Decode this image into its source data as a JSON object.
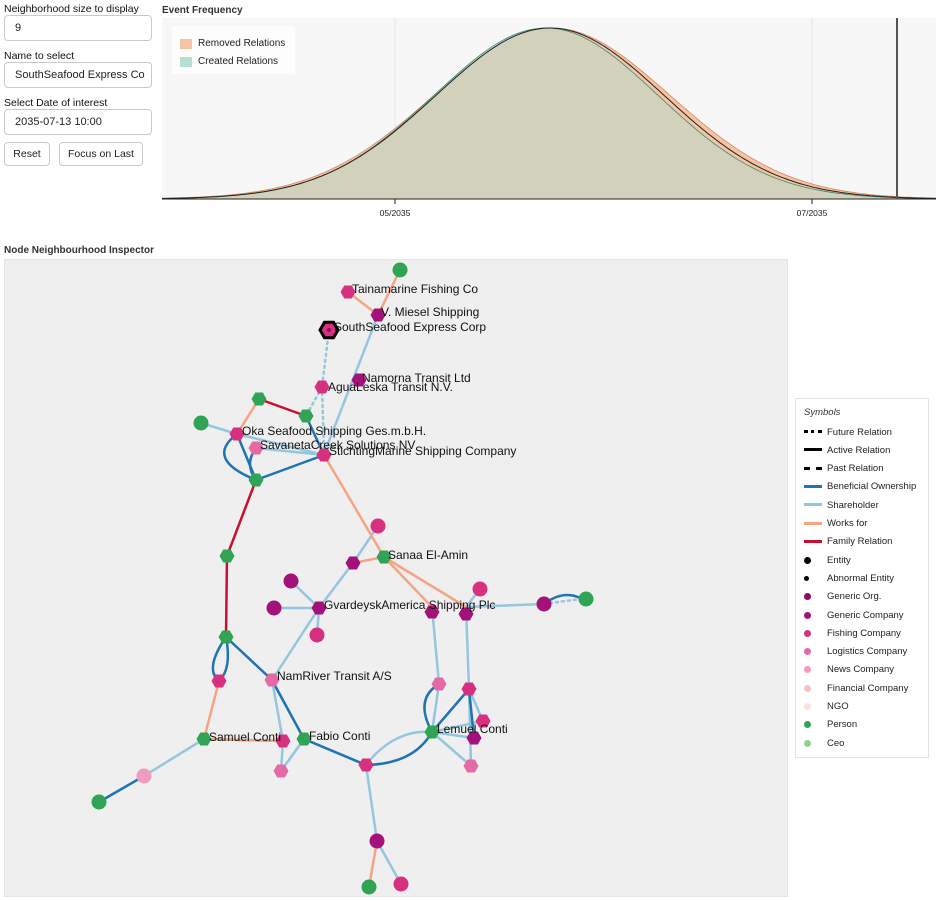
{
  "controls": {
    "neighborhood_label": "Neighborhood size to display",
    "neighborhood_value": "9",
    "name_label": "Name to select",
    "name_value": "SouthSeafood Express Co",
    "date_label": "Select Date of interest",
    "date_value": "2035-07-13 10:00",
    "reset_label": "Reset",
    "focus_label": "Focus on Last"
  },
  "event_frequency": {
    "title": "Event Frequency",
    "legend": [
      "Removed Relations",
      "Created Relations"
    ],
    "colors": {
      "removed": "#f4c4a5",
      "created": "#b6dfcf",
      "overlap": "#b1bf9c"
    },
    "x_ticks": [
      "05/2035",
      "07/2035"
    ]
  },
  "chart_data": {
    "type": "area",
    "title": "Event Frequency",
    "xlabel": "",
    "ylabel": "",
    "x_ticks": [
      "05/2035",
      "07/2035"
    ],
    "grid": true,
    "legend_position": "top-left",
    "series": [
      {
        "name": "Removed Relations",
        "color": "#f4c4a5"
      },
      {
        "name": "Created Relations",
        "color": "#b6dfcf"
      }
    ],
    "marker_date": "2035-07-13 10:00"
  },
  "graph": {
    "title": "Node Neighbourhood Inspector",
    "labels": {
      "tainamarine": "Tainamarine Fishing Co",
      "miesel": "V. Miesel Shipping",
      "southseafood": "SouthSeafood Express Corp",
      "namorna": "Namorna Transit Ltd",
      "agualeska": "AguaLeska Transit N.V.",
      "oka": "Oka Seafood Shipping Ges.m.b.H.",
      "savaneta": "SavanetaCreek Solutions NV",
      "stichting": "StichtingMarine Shipping Company",
      "sanaa": "Sanaa El-Amin",
      "gvardeysk": "GvardeyskAmerica Shipping Plc",
      "namriver": "NamRiver Transit A/S",
      "samuel": "Samuel Conti",
      "fabio": "Fabio Conti",
      "lemuel": "Lemuel Conti"
    }
  },
  "legend": {
    "title": "Symbols",
    "items": [
      "Future Relation",
      "Active Relation",
      "Past Relation",
      "Beneficial Ownership",
      "Shareholder",
      "Works for",
      "Family Relation",
      "Entity",
      "Abnormal Entity",
      "Generic Org.",
      "Generic Company",
      "Fishing Company",
      "Logistics Company",
      "News Company",
      "Financial Company",
      "NGO",
      "Person",
      "Ceo"
    ],
    "colors": {
      "beneficial": "#1f74b1",
      "shareholder": "#94c6e0",
      "works_for": "#f4a582",
      "family": "#c8102e",
      "generic_org": "#8b0a65",
      "generic_company": "#a3127a",
      "fishing": "#d6307f",
      "logistics": "#e46aa6",
      "news": "#f09cbf",
      "financial": "#f7c1c1",
      "ngo": "#fde3dd",
      "person": "#30a354",
      "ceo": "#8fd18f"
    }
  }
}
